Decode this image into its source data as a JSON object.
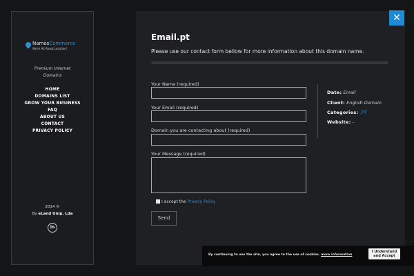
{
  "sidebar": {
    "logo": {
      "brand_part1": "Names",
      "brand_part2": "Commerce",
      "tagline": "We're All About Location!"
    },
    "subtitle_line1": "Premium Internet",
    "subtitle_line2": "Domains",
    "menu": [
      "HOME",
      "DOMAINS LIST",
      "GROW YOUR BUSINESS",
      "FAQ",
      "ABOUT US",
      "CONTACT",
      "PRIVACY POLICY"
    ],
    "copyright_line1": "2014 ©",
    "copyright_by": "By",
    "copyright_company": "eLand Unip. Lda",
    "linkedin_label": "in"
  },
  "main": {
    "close_label": "✕",
    "title": "Email.pt",
    "intro": "Please use our contact form bellow for more information about this domain name.",
    "form": {
      "name_label": "Your Name (required)",
      "email_label": "Your Email (required)",
      "domain_label": "Domain you are contacting about (required)",
      "message_label": "Your Message (required)",
      "name_value": "",
      "email_value": "",
      "domain_value": "",
      "message_value": "",
      "accept_text": "I accept the",
      "privacy_link": "Privacy Policy",
      "send_label": "Send"
    },
    "info": {
      "date_label": "Date:",
      "date_value": "Email",
      "client_label": "Client:",
      "client_value": "English Domain",
      "categories_label": "Categories:",
      "categories_value": ".PT",
      "website_label": "Website:",
      "website_value": "-"
    }
  },
  "cookie": {
    "text": "By continuing to use the site, you agree to the use of cookies.",
    "more": "more information",
    "button_line1": "I Understand",
    "button_line2": "and Accept"
  },
  "colors": {
    "accent": "#1e8bd2",
    "background": "#141517",
    "panel": "#1f2023"
  }
}
